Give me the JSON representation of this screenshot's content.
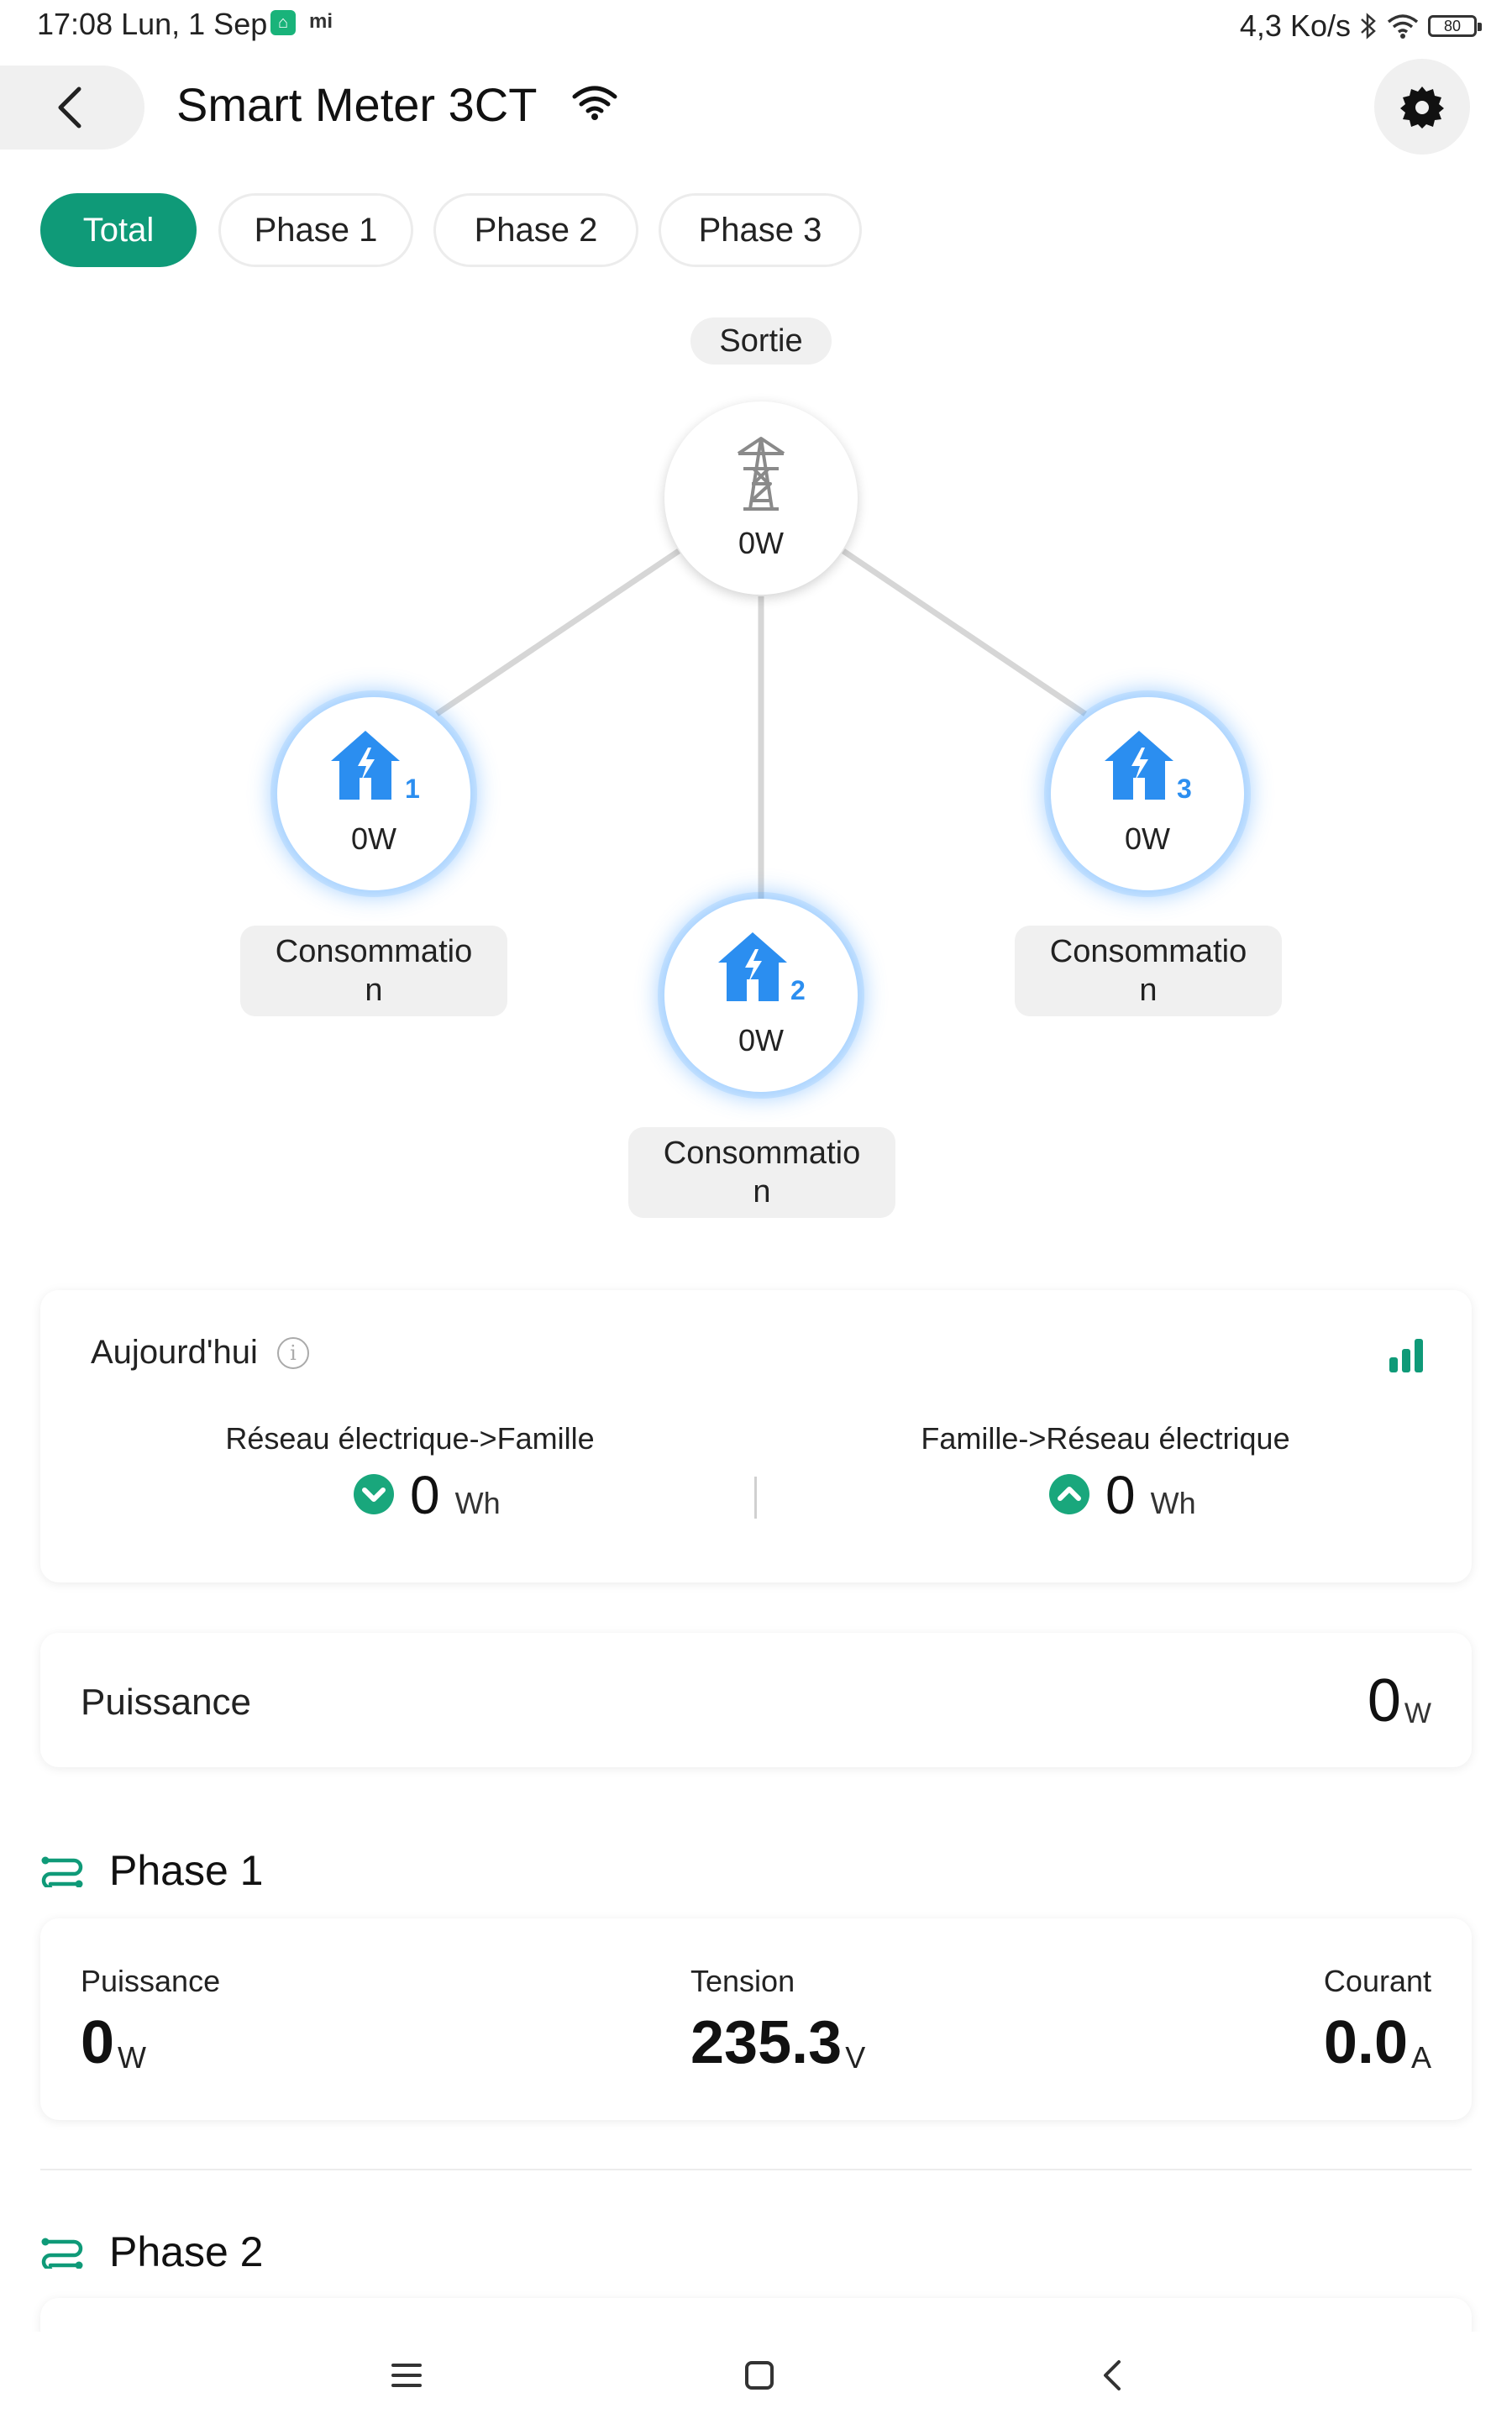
{
  "status_bar": {
    "time": "17:08 Lun, 1 Sep",
    "mi_label": "mi",
    "speed": "4,3 Ko/s",
    "battery": "80"
  },
  "header": {
    "title": "Smart Meter 3CT"
  },
  "tabs": [
    {
      "label": "Total",
      "active": true
    },
    {
      "label": "Phase 1",
      "active": false
    },
    {
      "label": "Phase 2",
      "active": false
    },
    {
      "label": "Phase 3",
      "active": false
    }
  ],
  "diagram": {
    "grid_label": "Sortie",
    "grid_value": "0W",
    "houses": [
      {
        "number": "1",
        "value": "0W",
        "label": "Consommation"
      },
      {
        "number": "2",
        "value": "0W",
        "label": "Consommation"
      },
      {
        "number": "3",
        "value": "0W",
        "label": "Consommation"
      }
    ]
  },
  "today": {
    "title": "Aujourd'hui",
    "import_label": "Réseau électrique->Famille",
    "import_value": "0",
    "import_unit": "Wh",
    "export_label": "Famille->Réseau électrique",
    "export_value": "0",
    "export_unit": "Wh"
  },
  "power": {
    "label": "Puissance",
    "value": "0",
    "unit": "W"
  },
  "phase1": {
    "title": "Phase 1",
    "power_label": "Puissance",
    "power_value": "0",
    "power_unit": "W",
    "voltage_label": "Tension",
    "voltage_value": "235.3",
    "voltage_unit": "V",
    "current_label": "Courant",
    "current_value": "0.0",
    "current_unit": "A"
  },
  "phase2": {
    "title": "Phase 2"
  },
  "colors": {
    "accent": "#0f9a78",
    "house_blue": "#2b8ef0"
  }
}
